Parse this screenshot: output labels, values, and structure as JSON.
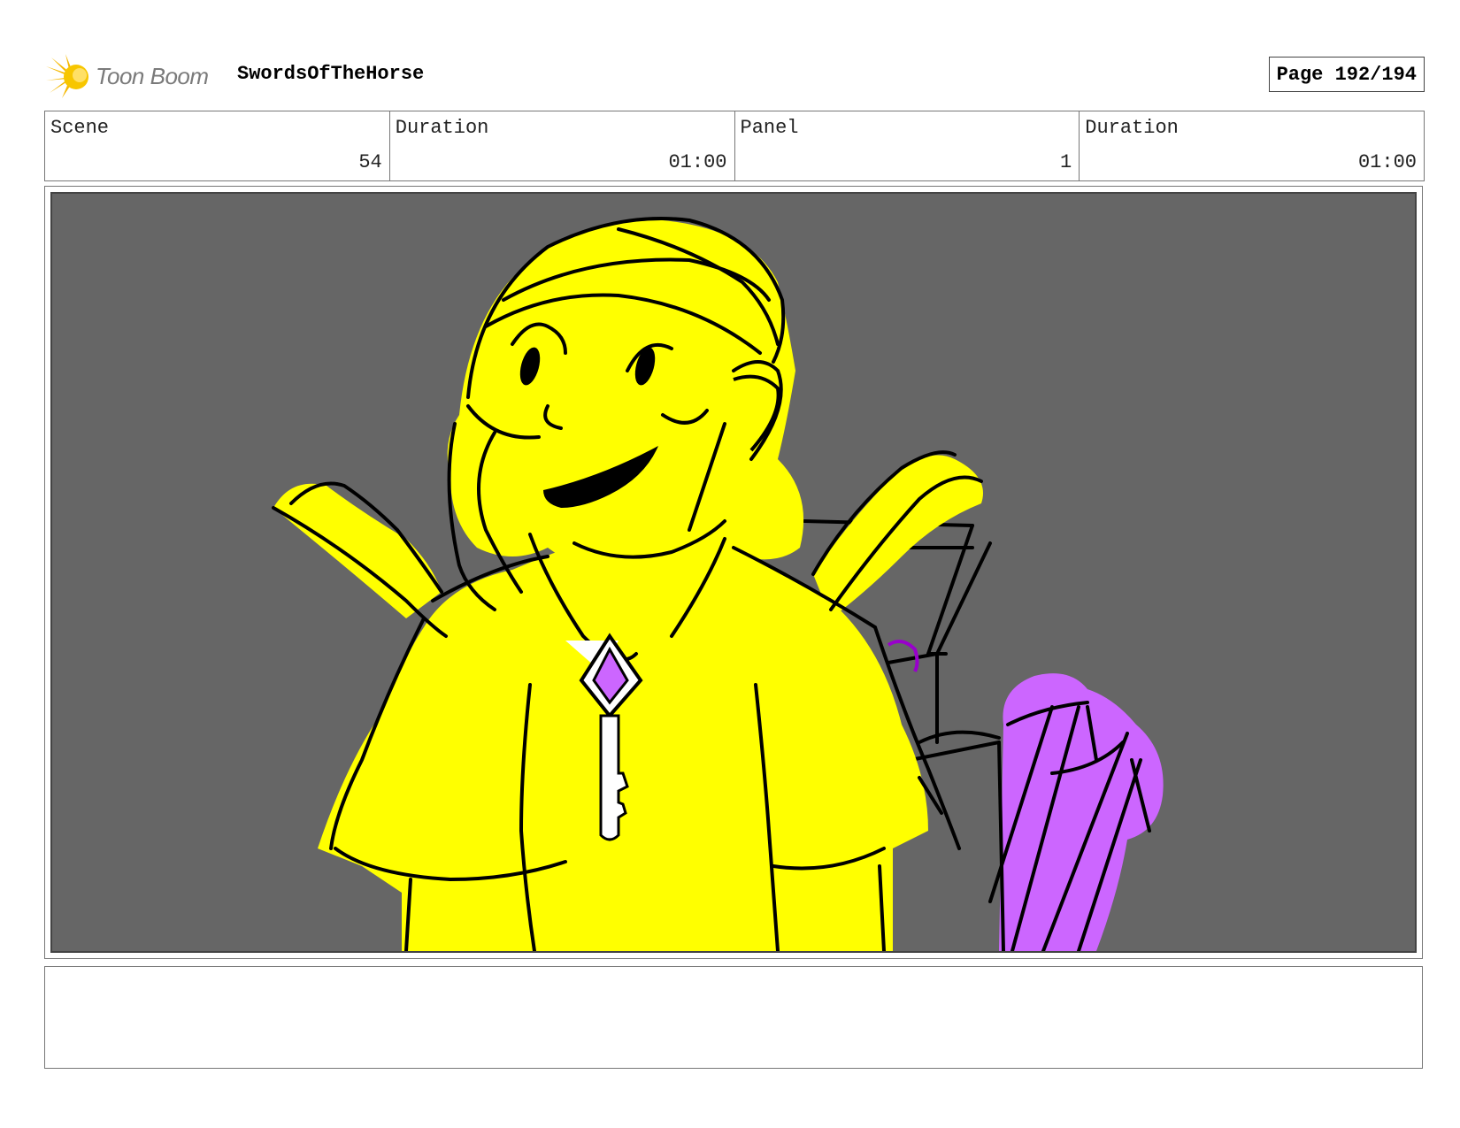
{
  "header": {
    "logo_text": "Toon Boom",
    "project_title": "SwordsOfTheHorse",
    "page_label": "Page 192/194"
  },
  "info": [
    {
      "label": "Scene",
      "value": "54"
    },
    {
      "label": "Duration",
      "value": "01:00"
    },
    {
      "label": "Panel",
      "value": "1"
    },
    {
      "label": "Duration",
      "value": "01:00"
    }
  ],
  "panel": {
    "background_color": "#666666",
    "character_fill_color": "#ffff00",
    "accent_color": "#cc66ff",
    "description_icons": [
      "character-sketch",
      "key-pendant",
      "chair-sketch",
      "purple-object"
    ]
  },
  "notes": {
    "text": ""
  }
}
